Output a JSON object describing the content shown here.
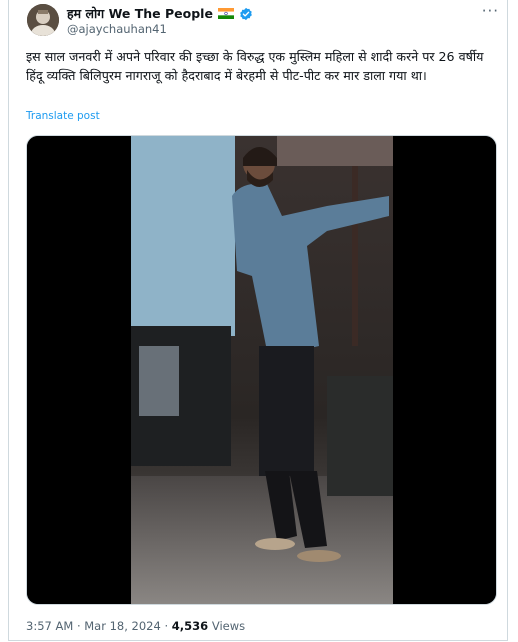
{
  "author": {
    "display_name": "हम लोग We The People",
    "handle": "@ajaychauhan41",
    "flag_icon": "india-flag-icon",
    "verified_icon": "verified-badge-icon",
    "verified_color": "#1d9bf0"
  },
  "more_label": "···",
  "tweet": {
    "text": "इस साल जनवरी में अपने परिवार की इच्छा के विरुद्ध एक मुस्लिम महिला से शादी करने पर 26 वर्षीय हिंदू व्यक्ति बिलिपुरम नागराजू को हैदराबाद में बेरहमी से पीट-पीट कर मार डाला गया था।",
    "translate_label": "Translate post"
  },
  "meta": {
    "time": "3:57 AM",
    "separator": "·",
    "date": "Mar 18, 2024",
    "views_count": "4,536",
    "views_label": "Views"
  },
  "colors": {
    "link": "#1d9bf0",
    "secondary_text": "#536471",
    "border": "#cfd9de"
  }
}
